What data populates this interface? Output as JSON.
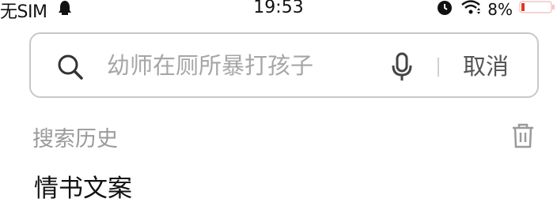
{
  "status_bar": {
    "carrier": "无SIM",
    "time": "19:53",
    "battery_percent": "8%"
  },
  "search": {
    "placeholder": "幼师在厕所暴打孩子",
    "value": "",
    "cancel_label": "取消"
  },
  "history": {
    "title": "搜索历史",
    "items": [
      "情书文案"
    ]
  },
  "icons": {
    "search": "search-icon",
    "mic": "mic-icon",
    "trash": "trash-icon",
    "alarm": "alarm-icon",
    "wifi": "wifi-icon",
    "notification": "notification-icon",
    "battery": "battery-icon"
  },
  "colors": {
    "battery_low": "#e0362b",
    "border": "#c8c8c8",
    "placeholder": "#a6a6a6"
  }
}
